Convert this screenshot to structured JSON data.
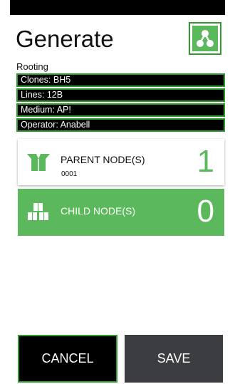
{
  "header": {
    "title": "Generate",
    "subtitle": "Rooting",
    "app_icon": "tree-nodes-icon"
  },
  "info": [
    {
      "text": "Clones: BH5"
    },
    {
      "text": "Lines: 12B"
    },
    {
      "text": "Medium: AP!"
    },
    {
      "text": "Operator: Anabell"
    }
  ],
  "parent": {
    "label": "PARENT NODE(S)",
    "sub": "0001",
    "count": "1",
    "icon": "open-box-icon"
  },
  "child": {
    "label": "CHILD NODE(S)",
    "count": "0",
    "icon": "stacked-boxes-icon"
  },
  "actions": {
    "cancel_label": "CANCEL",
    "save_label": "SAVE"
  },
  "colors": {
    "accent": "#5cb85c",
    "border": "#2e9b2e",
    "dark": "#000000",
    "save_bg": "#3b3d40"
  }
}
